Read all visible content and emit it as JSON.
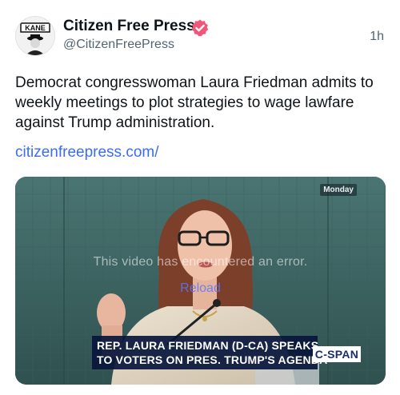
{
  "post": {
    "author_name": "Citizen Free Press",
    "author_handle": "@CitizenFreePress",
    "time": "1h",
    "text": "Democrat congresswoman Laura Friedman admits to weekly meetings to plot strategies to wage lawfare against Trump administration.",
    "link": "citizenfreepress.com/",
    "avatar_text": "KANE",
    "verified_color": "#f0567a",
    "link_color": "#3b6df0"
  },
  "video": {
    "day_badge": "Monday",
    "error_message": "This video has encountered an error.",
    "reload_label": "Reload",
    "chyron_line1": "REP. LAURA FRIEDMAN (D-CA) SPEAKS",
    "chyron_line2": "TO VOTERS ON PRES. TRUMP'S AGENDA",
    "network": "C-SPAN"
  }
}
